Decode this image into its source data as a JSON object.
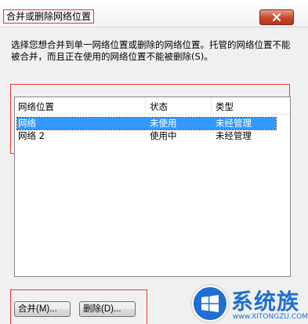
{
  "window": {
    "title": "合并或删除网络位置",
    "close_icon": "close-icon"
  },
  "description": "选择您想合并到单一网络位置或删除的网络位置。托管的网络位置不能被合并，而且正在使用的网络位置不能被删除(S)。",
  "list": {
    "columns": [
      "网络位置",
      "状态",
      "类型"
    ],
    "rows": [
      {
        "name": "网络",
        "status": "未使用",
        "type": "未经管理",
        "selected": true
      },
      {
        "name": "网络  2",
        "status": "使用中",
        "type": "未经管理",
        "selected": false
      }
    ]
  },
  "buttons": {
    "merge": "合并(M)...",
    "delete": "删除(D)..."
  },
  "watermark": {
    "text": "系统族",
    "url": "www.XITONGZU.COM",
    "icon": "windows-logo-icon"
  }
}
